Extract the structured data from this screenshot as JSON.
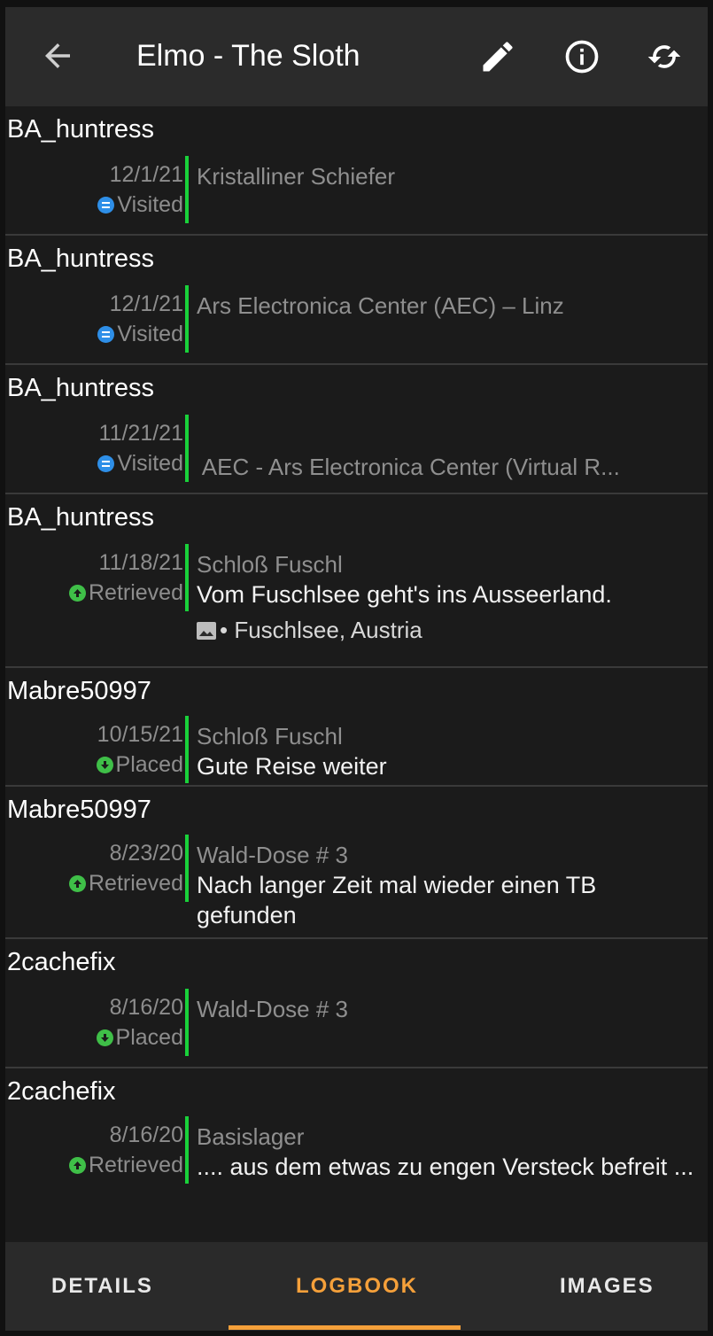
{
  "appbar": {
    "title": "Elmo - The Sloth",
    "icons": [
      "back-arrow-icon",
      "edit-pencil-icon",
      "info-icon",
      "refresh-icon"
    ]
  },
  "colors": {
    "accent": "#f5a03a",
    "found_bar": "#19d13a",
    "visited": "#2e8fe8",
    "retrieved": "#3fbf48"
  },
  "entries": [
    {
      "author": "BA_huntress",
      "date": "12/1/21",
      "type": "Visited",
      "type_icon": "visited-icon",
      "cache": "Kristalliner Schiefer",
      "text": "",
      "attachment": ""
    },
    {
      "author": "BA_huntress",
      "date": "12/1/21",
      "type": "Visited",
      "type_icon": "visited-icon",
      "cache": "Ars Electronica Center (AEC) – Linz",
      "text": "",
      "attachment": ""
    },
    {
      "author": "BA_huntress",
      "date": "11/21/21",
      "type": "Visited",
      "type_icon": "visited-icon",
      "cache": " AEC - Ars Electronica Center (Virtual R...",
      "text": "",
      "attachment": ""
    },
    {
      "author": "BA_huntress",
      "date": "11/18/21",
      "type": "Retrieved",
      "type_icon": "retrieved-icon",
      "cache": "Schloß Fuschl",
      "text": "Vom Fuschlsee geht's ins Ausseerland.",
      "attachment": "• Fuschlsee, Austria"
    },
    {
      "author": "Mabre50997",
      "date": "10/15/21",
      "type": "Placed",
      "type_icon": "placed-icon",
      "cache": "Schloß Fuschl",
      "text": "Gute Reise weiter",
      "attachment": ""
    },
    {
      "author": "Mabre50997",
      "date": "8/23/20",
      "type": "Retrieved",
      "type_icon": "retrieved-icon",
      "cache": "Wald-Dose # 3",
      "text": "Nach langer Zeit mal wieder einen TB gefunden",
      "attachment": ""
    },
    {
      "author": "2cachefix",
      "date": "8/16/20",
      "type": "Placed",
      "type_icon": "placed-icon",
      "cache": "Wald-Dose # 3",
      "text": "",
      "attachment": ""
    },
    {
      "author": "2cachefix",
      "date": "8/16/20",
      "type": "Retrieved",
      "type_icon": "retrieved-icon",
      "cache": "Basislager",
      "text": ".... aus dem etwas zu engen Versteck befreit ...",
      "attachment": ""
    }
  ],
  "tabs": [
    {
      "label": "DETAILS",
      "active": false
    },
    {
      "label": "LOGBOOK",
      "active": true
    },
    {
      "label": "IMAGES",
      "active": false
    }
  ]
}
